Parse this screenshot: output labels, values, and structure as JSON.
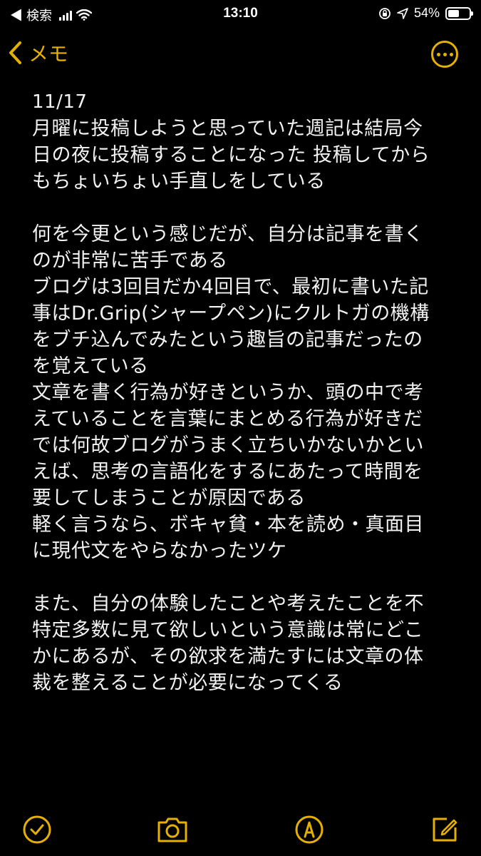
{
  "status_bar": {
    "carrier": "◀ 検索",
    "time": "13:10",
    "battery_percent": "54%",
    "battery_level": 0.54
  },
  "nav": {
    "back_label": "メモ",
    "more_icon": "ellipsis-circle-icon"
  },
  "note": {
    "date": "11/17",
    "lines": [
      "月曜に投稿しようと思っていた週記は結局今",
      "日の夜に投稿することになった 投稿してから",
      "もちょいちょい手直しをしている",
      "",
      "何を今更という感じだが、自分は記事を書く",
      "のが非常に苦手である",
      "ブログは3回目だか4回目で、最初に書いた記",
      "事はDr.Grip(シャープペン)にクルトガの機構",
      "をブチ込んでみたという趣旨の記事だったの",
      "を覚えている",
      "文章を書く行為が好きというか、頭の中で考",
      "えていることを言葉にまとめる行為が好きだ",
      "では何故ブログがうまく立ちいかないかとい",
      "えば、思考の言語化をするにあたって時間を",
      "要してしまうことが原因である",
      "軽く言うなら、ボキャ貧・本を読め・真面目",
      "に現代文をやらなかったツケ",
      "",
      "また、自分の体験したことや考えたことを不",
      "特定多数に見て欲しいという意識は常にどこ",
      "かにあるが、その欲求を満たすには文章の体",
      "裁を整えることが必要になってくる"
    ]
  },
  "toolbar": {
    "icons": [
      "checkmark-circle-icon",
      "camera-icon",
      "markup-pen-icon",
      "compose-icon"
    ]
  },
  "colors": {
    "accent": "#e5b000",
    "background": "#000000",
    "text": "#f2f2f2"
  }
}
